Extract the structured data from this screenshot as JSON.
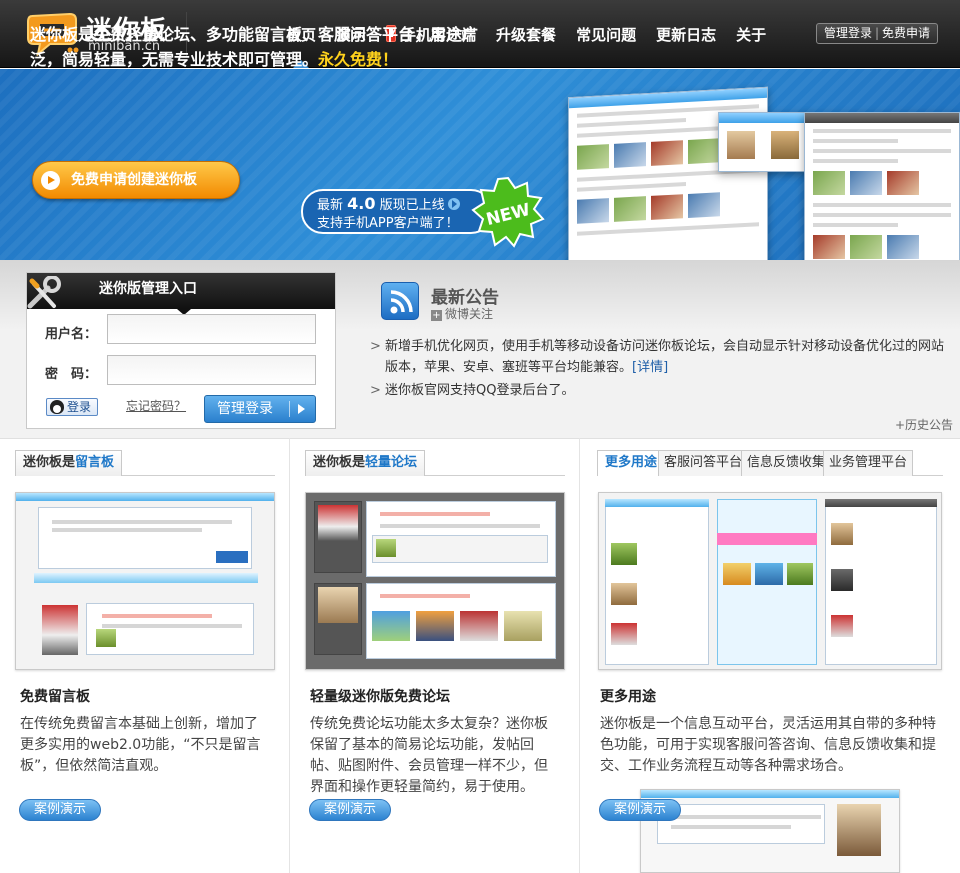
{
  "header": {
    "logo_cn": "迷你板",
    "logo_en": "miniban.cn",
    "nav": [
      {
        "label": "首页",
        "active": true
      },
      {
        "label": "演示"
      },
      {
        "label": "手机客户端",
        "icon": "mobile-phone-icon"
      },
      {
        "label": "升级套餐"
      },
      {
        "label": "常见问题"
      },
      {
        "label": "更新日志"
      },
      {
        "label": "关于"
      }
    ],
    "admin_login": "管理登录",
    "free_apply": "免费申请"
  },
  "banner": {
    "headline_1": "迷你板是免费轻量论坛、多功能留言板、客服问答平台，用途广泛，简易轻量，无需专业技术即可管理。",
    "headline_free": "永久免费！",
    "cta_label": "免费申请创建迷你板",
    "version_prefix": "最新",
    "version_number": "4.0",
    "version_suffix": "版现已上线",
    "app_line": "支持手机APP客户端了！",
    "new_badge": "NEW"
  },
  "login": {
    "title": "迷你版管理入口",
    "username_label": "用户名：",
    "password_label": "密　码：",
    "qq_login": "登录",
    "forgot": "忘记密码？",
    "submit": "管理登录"
  },
  "notice": {
    "title": "最新公告",
    "weibo": "微博关注",
    "items": [
      {
        "text": "新增手机优化网页，使用手机等移动设备访问迷你板论坛，会自动显示针对移动设备优化过的网站版本，苹果、安卓、塞班等平台均能兼容。",
        "detail": "[详情]"
      },
      {
        "text": "迷你板官网支持QQ登录后台了。"
      }
    ],
    "history": "+历史公告"
  },
  "columns": [
    {
      "tab_prefix": "迷你板是",
      "tab_highlight": "留言板",
      "title": "免费留言板",
      "desc": "在传统免费留言本基础上创新，增加了更多实用的web2.0功能，“不只是留言板”，但依然简洁直观。",
      "demo": "案例演示"
    },
    {
      "tab_prefix": "迷你板是",
      "tab_highlight": "轻量论坛",
      "title": "轻量级迷你版免费论坛",
      "desc": "传统免费论坛功能太多太复杂？迷你板保留了基本的简易论坛功能，发帖回帖、贴图附件、会员管理一样不少，但界面和操作更轻量简约，易于使用。",
      "demo": "案例演示"
    },
    {
      "tabs": [
        "更多用途",
        "客服问答平台",
        "信息反馈收集",
        "业务管理平台"
      ],
      "title": "更多用途",
      "desc": "迷你板是一个信息互动平台，灵活运用其自带的多种特色功能，可用于实现客服问答咨询、信息反馈收集和提交、工作业务流程互动等各种需求场合。",
      "demo": "案例演示"
    }
  ],
  "colors": {
    "header_bg": "#1e1e1e",
    "banner_blue": "#2f8fd8",
    "accent_orange": "#f28a00",
    "free_yellow": "#ffd21c",
    "link_blue": "#1f78c8"
  }
}
